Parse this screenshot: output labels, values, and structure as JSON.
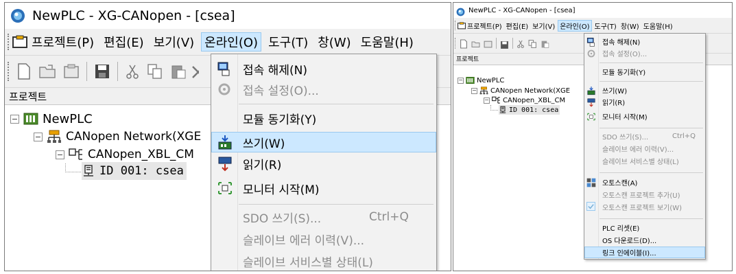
{
  "app": {
    "title": "NewPLC - XG-CANopen - [csea]"
  },
  "menu": [
    "프로젝트(P)",
    "편집(E)",
    "보기(V)",
    "온라인(O)",
    "도구(T)",
    "창(W)",
    "도움말(H)"
  ],
  "panel_title": "프로젝트",
  "tree": {
    "root": "NewPLC",
    "network_left": "CANopen Network(XGE",
    "network_right": "CANopen Network(XGE",
    "module_left": "CANopen_XBL_CM",
    "module_right": "CANopen_XBL_CM",
    "node": "ID 001: csea"
  },
  "left_dropdown": {
    "items": [
      {
        "label": "접속 해제(N)"
      },
      {
        "label": "접속 설정(O)..."
      },
      {
        "label": "모듈 동기화(Y)"
      },
      {
        "label": "쓰기(W)"
      },
      {
        "label": "읽기(R)"
      },
      {
        "label": "모니터 시작(M)"
      },
      {
        "label": "SDO 쓰기(S)...",
        "shortcut": "Ctrl+Q"
      },
      {
        "label": "슬레이브 에러 이력(V)..."
      },
      {
        "label": "슬레이브 서비스별 상태(L)"
      }
    ]
  },
  "right_dropdown": {
    "items": [
      {
        "label": "접속 해제(N)"
      },
      {
        "label": "접속 설정(O)..."
      },
      {
        "label": "모듈 동기화(Y)"
      },
      {
        "label": "쓰기(W)"
      },
      {
        "label": "읽기(R)"
      },
      {
        "label": "모니터 시작(M)"
      },
      {
        "label": "SDO 쓰기(S)...",
        "shortcut": "Ctrl+Q"
      },
      {
        "label": "슬레이브 에러 이력(V)..."
      },
      {
        "label": "슬레이브 서비스별 상태(L)"
      },
      {
        "label": "오토스캔(A)"
      },
      {
        "label": "오토스캔 프로젝트 추가(U)"
      },
      {
        "label": "오토스캔 프로젝트 보기(W)"
      },
      {
        "label": "PLC 리셋(E)"
      },
      {
        "label": "OS 다운로드(D)..."
      },
      {
        "label": "링크 인에이블(I)..."
      }
    ]
  },
  "colors": {
    "highlight": "#cce8ff",
    "highlight_border": "#99c9ef",
    "disabled_text": "#8c8c8c"
  }
}
